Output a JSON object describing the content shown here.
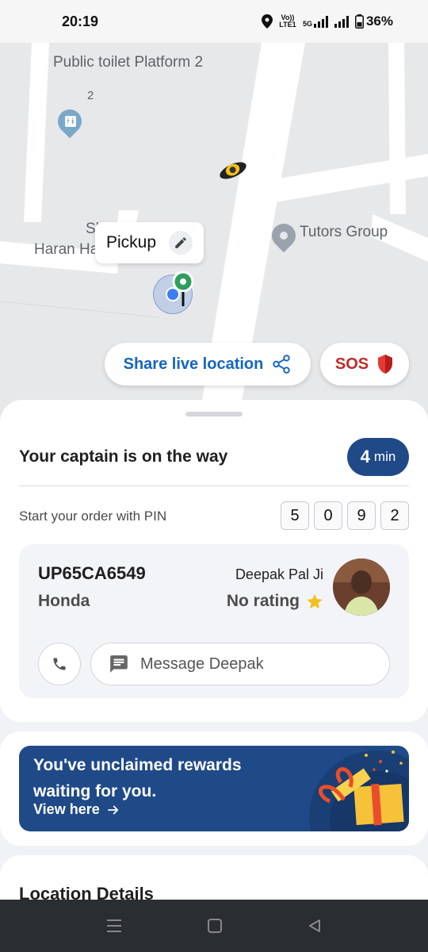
{
  "status_bar": {
    "time": "20:19",
    "network_label_top": "Vo)) LTE1",
    "network_label_5g": "5G",
    "battery": "36%"
  },
  "map": {
    "labels": {
      "toilet": "Public toilet Platform 2",
      "marker_number": "2",
      "place_partial_1": "Sh",
      "place_partial_2": "Haran Ha",
      "tutors": "Tutors Group"
    },
    "pickup_label": "Pickup"
  },
  "actions": {
    "share_label": "Share live location",
    "sos_label": "SOS"
  },
  "trip": {
    "status_title": "Your captain is on the way",
    "eta_value": "4",
    "eta_unit": "min",
    "pin_label": "Start your order with PIN",
    "pin_digits": [
      "5",
      "0",
      "9",
      "2"
    ]
  },
  "driver": {
    "plate": "UP65CA6549",
    "vehicle": "Honda",
    "name": "Deepak Pal Ji",
    "rating_text": "No rating",
    "message_placeholder": "Message Deepak"
  },
  "rewards": {
    "title": "You've unclaimed rewards waiting for you.",
    "link_label": "View here"
  },
  "location_details": {
    "title": "Location Details"
  },
  "colors": {
    "brand_blue": "#1f4a87",
    "share_text": "#1565c0",
    "sos_red": "#c62828",
    "star": "#f4c01e"
  }
}
